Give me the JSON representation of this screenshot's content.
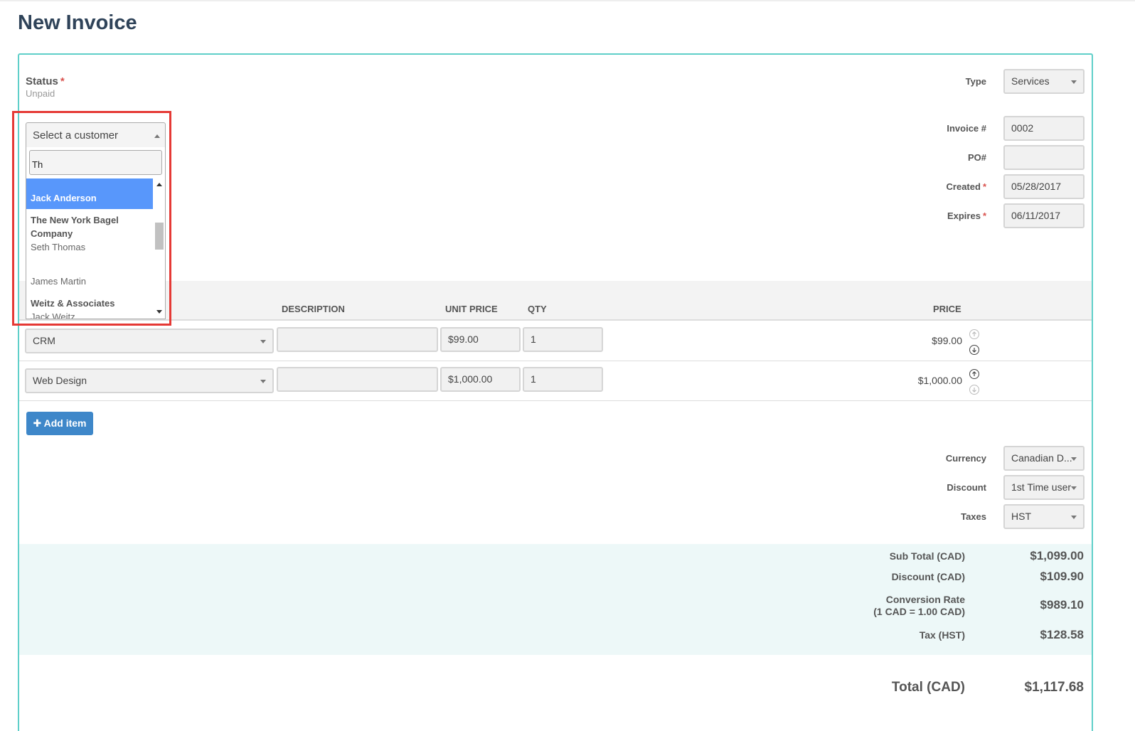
{
  "page": {
    "title": "New Invoice"
  },
  "status": {
    "label": "Status",
    "required": "*",
    "value": "Unpaid"
  },
  "customer_dropdown": {
    "placeholder": "Select a customer",
    "search_value": "Th",
    "options": [
      {
        "name": "Jack Anderson",
        "sub": "",
        "highlighted": true
      },
      {
        "name": "The New York Bagel Company",
        "sub": "Seth Thomas"
      },
      {
        "name": "",
        "sub": "James Martin"
      },
      {
        "name": "Weitz & Associates",
        "sub": "Jack Weitz"
      }
    ]
  },
  "meta": {
    "type_label": "Type",
    "type_value": "Services",
    "invoice_label": "Invoice #",
    "invoice_value": "0002",
    "po_label": "PO#",
    "po_value": "",
    "created_label": "Created",
    "created_value": "05/28/2017",
    "expires_label": "Expires",
    "expires_value": "06/11/2017",
    "required": "*"
  },
  "items_table": {
    "headers": {
      "description": "DESCRIPTION",
      "unit_price": "UNIT PRICE",
      "qty": "QTY",
      "price": "PRICE"
    },
    "rows": [
      {
        "product": "CRM",
        "description": "",
        "unit_price": "$99.00",
        "qty": "1",
        "price": "$99.00"
      },
      {
        "product": "Web Design",
        "description": "",
        "unit_price": "$1,000.00",
        "qty": "1",
        "price": "$1,000.00"
      }
    ],
    "add_item_label": "Add item"
  },
  "options": {
    "currency_label": "Currency",
    "currency_value": "Canadian D...",
    "discount_label": "Discount",
    "discount_value": "1st Time user",
    "taxes_label": "Taxes",
    "taxes_value": "HST"
  },
  "totals": {
    "subtotal_label": "Sub Total (CAD)",
    "subtotal_value": "$1,099.00",
    "discount_label": "Discount (CAD)",
    "discount_value": "$109.90",
    "conversion_label_1": "Conversion Rate",
    "conversion_label_2": "(1 CAD = 1.00 CAD)",
    "conversion_value": "$989.10",
    "tax_label": "Tax (HST)",
    "tax_value": "$128.58",
    "total_label": "Total (CAD)",
    "total_value": "$1,117.68"
  },
  "colors": {
    "accent_border": "#5fcfc9",
    "button": "#3e87c9",
    "highlight": "#5897fb",
    "annotation": "#e53935",
    "totals_band": "#edf8f8"
  }
}
